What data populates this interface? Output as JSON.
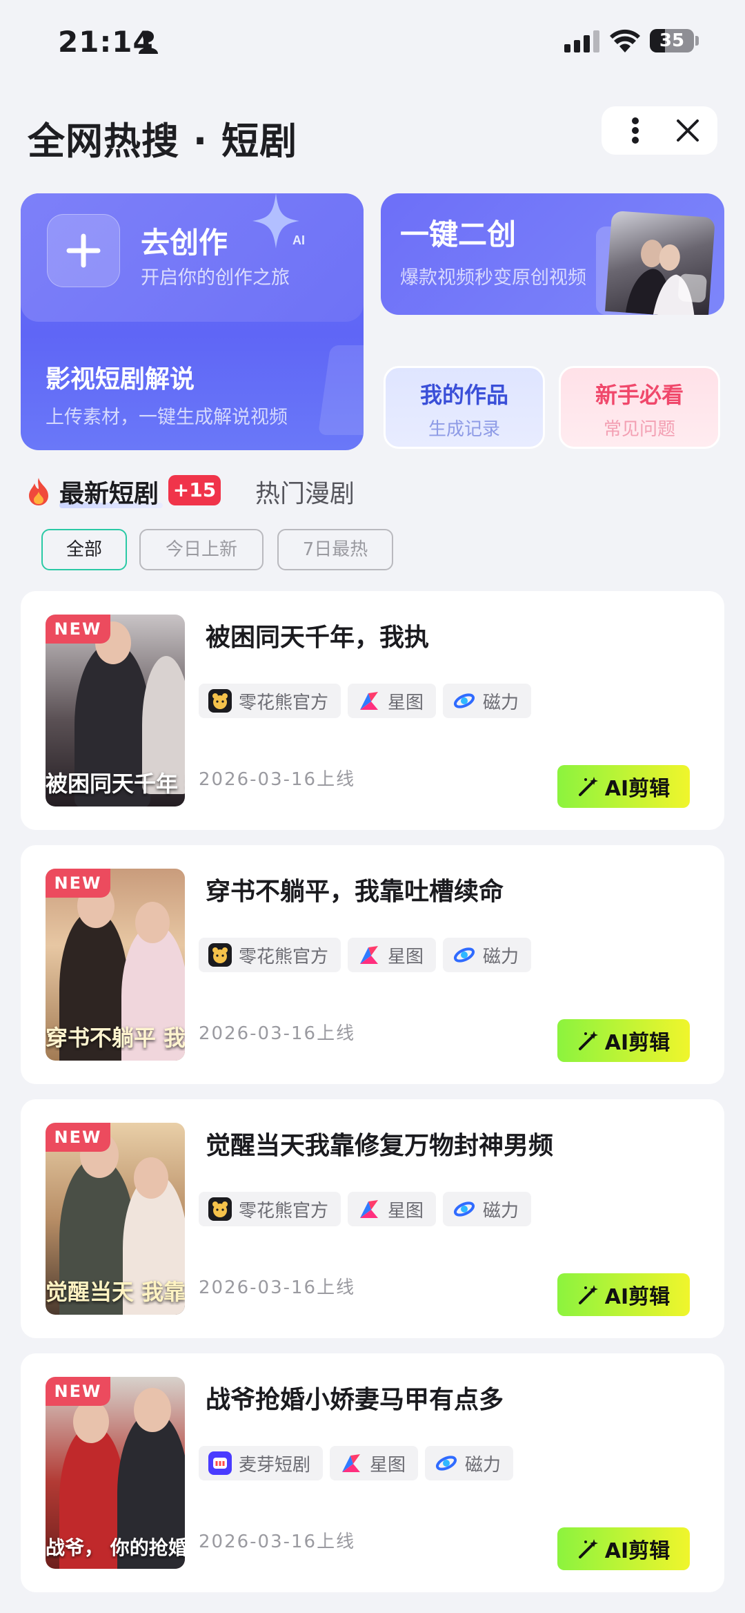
{
  "status_bar": {
    "time": "21:14",
    "battery": "35",
    "battery_level": 0.35
  },
  "header": {
    "title": "全网热搜 · 短剧"
  },
  "create_card": {
    "title": "去创作",
    "subtitle": "开启你的创作之旅",
    "explain_title": "影视短剧解说",
    "explain_subtitle": "上传素材，一键生成解说视频"
  },
  "remix_card": {
    "title": "一键二创",
    "subtitle": "爆款视频秒变原创视频"
  },
  "my_works": {
    "title": "我的作品",
    "subtitle": "生成记录"
  },
  "guide": {
    "title": "新手必看",
    "subtitle": "常见问题"
  },
  "tabs": {
    "latest": "最新短剧",
    "badge": "+15",
    "hot": "热门漫剧"
  },
  "filters": [
    "全部",
    "今日上新",
    "7日最热"
  ],
  "colors": {
    "accent": "#6b6ff7",
    "new_badge": "#ec4b5e",
    "ai_button_start": "#8cf33e",
    "ai_button_end": "#f0f52c",
    "chip_active": "#2ac9a5"
  },
  "dramas": [
    {
      "title": "被困同天千年，我执",
      "badge": "NEW",
      "poster_caption": "被困同天千年 我执棋定乾坤",
      "tags": [
        {
          "icon": "bear-logo-icon",
          "label": "零花熊官方"
        },
        {
          "icon": "xingtu-logo-icon",
          "label": "星图"
        },
        {
          "icon": "cili-logo-icon",
          "label": "磁力"
        }
      ],
      "date": "2026-03-16上线",
      "action": "AI剪辑"
    },
    {
      "title": "穿书不躺平，我靠吐槽续命",
      "badge": "NEW",
      "poster_caption": "穿书不躺平 我靠吐槽续命",
      "tags": [
        {
          "icon": "bear-logo-icon",
          "label": "零花熊官方"
        },
        {
          "icon": "xingtu-logo-icon",
          "label": "星图"
        },
        {
          "icon": "cili-logo-icon",
          "label": "磁力"
        }
      ],
      "date": "2026-03-16上线",
      "action": "AI剪辑"
    },
    {
      "title": "觉醒当天我靠修复万物封神男频",
      "badge": "NEW",
      "poster_caption": "觉醒当天 我靠修复",
      "tags": [
        {
          "icon": "bear-logo-icon",
          "label": "零花熊官方"
        },
        {
          "icon": "xingtu-logo-icon",
          "label": "星图"
        },
        {
          "icon": "cili-logo-icon",
          "label": "磁力"
        }
      ],
      "date": "2026-03-16上线",
      "action": "AI剪辑"
    },
    {
      "title": "战爷抢婚小娇妻马甲有点多",
      "badge": "NEW",
      "poster_caption": "战爷， 你的抢婚小娇妻 马甲有点多",
      "tags": [
        {
          "icon": "maiya-logo-icon",
          "label": "麦芽短剧"
        },
        {
          "icon": "xingtu-logo-icon",
          "label": "星图"
        },
        {
          "icon": "cili-logo-icon",
          "label": "磁力"
        }
      ],
      "date": "2026-03-16上线",
      "action": "AI剪辑"
    }
  ]
}
